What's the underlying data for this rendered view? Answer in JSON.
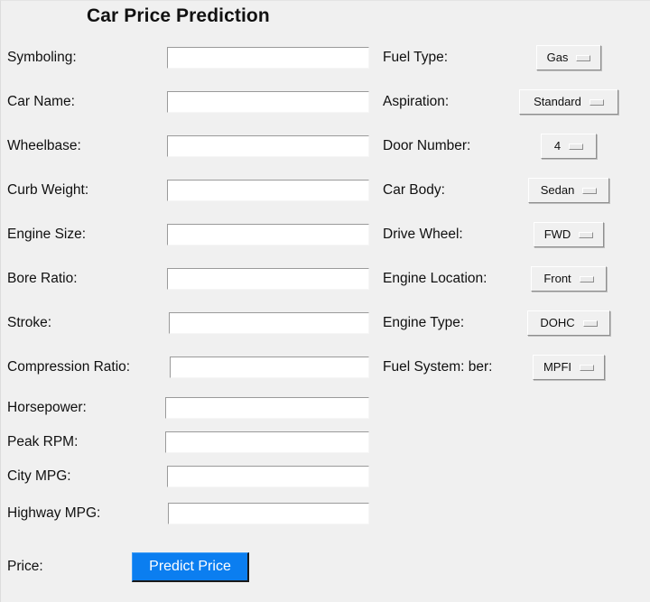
{
  "window": {
    "title": "Car Price Prediction",
    "background_color": "#f0f0f0"
  },
  "form": {
    "text_fields": [
      {
        "label": "Symboling:",
        "value": "",
        "placeholder": "",
        "name": "symboling"
      },
      {
        "label": "Car Name:",
        "value": "",
        "placeholder": "",
        "name": "car-name"
      },
      {
        "label": "Wheelbase:",
        "value": "",
        "placeholder": "",
        "name": "wheelbase"
      },
      {
        "label": "Curb Weight:",
        "value": "",
        "placeholder": "",
        "name": "curb-weight"
      },
      {
        "label": "Engine Size:",
        "value": "",
        "placeholder": "",
        "name": "engine-size"
      },
      {
        "label": "Bore Ratio:",
        "value": "",
        "placeholder": "",
        "name": "bore-ratio"
      },
      {
        "label": "Stroke:",
        "value": "",
        "placeholder": "",
        "name": "stroke"
      },
      {
        "label": "Compression Ratio:",
        "value": "",
        "placeholder": "",
        "name": "compression-ratio"
      },
      {
        "label": "Horsepower:",
        "value": "",
        "placeholder": "",
        "name": "horsepower"
      },
      {
        "label": "Peak RPM:",
        "value": "",
        "placeholder": "",
        "name": "peak-rpm"
      },
      {
        "label": "City MPG:",
        "value": "",
        "placeholder": "",
        "name": "city-mpg"
      },
      {
        "label": "Highway MPG:",
        "value": "",
        "placeholder": "",
        "name": "highway-mpg"
      }
    ],
    "dropdowns": [
      {
        "label": "Fuel Type:",
        "selected": "Gas",
        "name": "fuel-type"
      },
      {
        "label": "Aspiration:",
        "selected": "Standard",
        "name": "aspiration"
      },
      {
        "label": "Door Number:",
        "selected": "4",
        "name": "door-number"
      },
      {
        "label": "Car Body:",
        "selected": "Sedan",
        "name": "car-body"
      },
      {
        "label": "Drive Wheel:",
        "selected": "FWD",
        "name": "drive-wheel"
      },
      {
        "label": "Engine Location:",
        "selected": "Front",
        "name": "engine-location"
      },
      {
        "label": "Engine Type:",
        "selected": "DOHC",
        "name": "engine-type"
      },
      {
        "label": "Fuel System: ber:",
        "selected": "MPFI",
        "name": "fuel-system"
      }
    ],
    "price": {
      "label": "Price:",
      "value": ""
    },
    "predict_button": {
      "label": "Predict Price",
      "color": "#0b7ef0",
      "text_color": "#ffffff"
    }
  }
}
